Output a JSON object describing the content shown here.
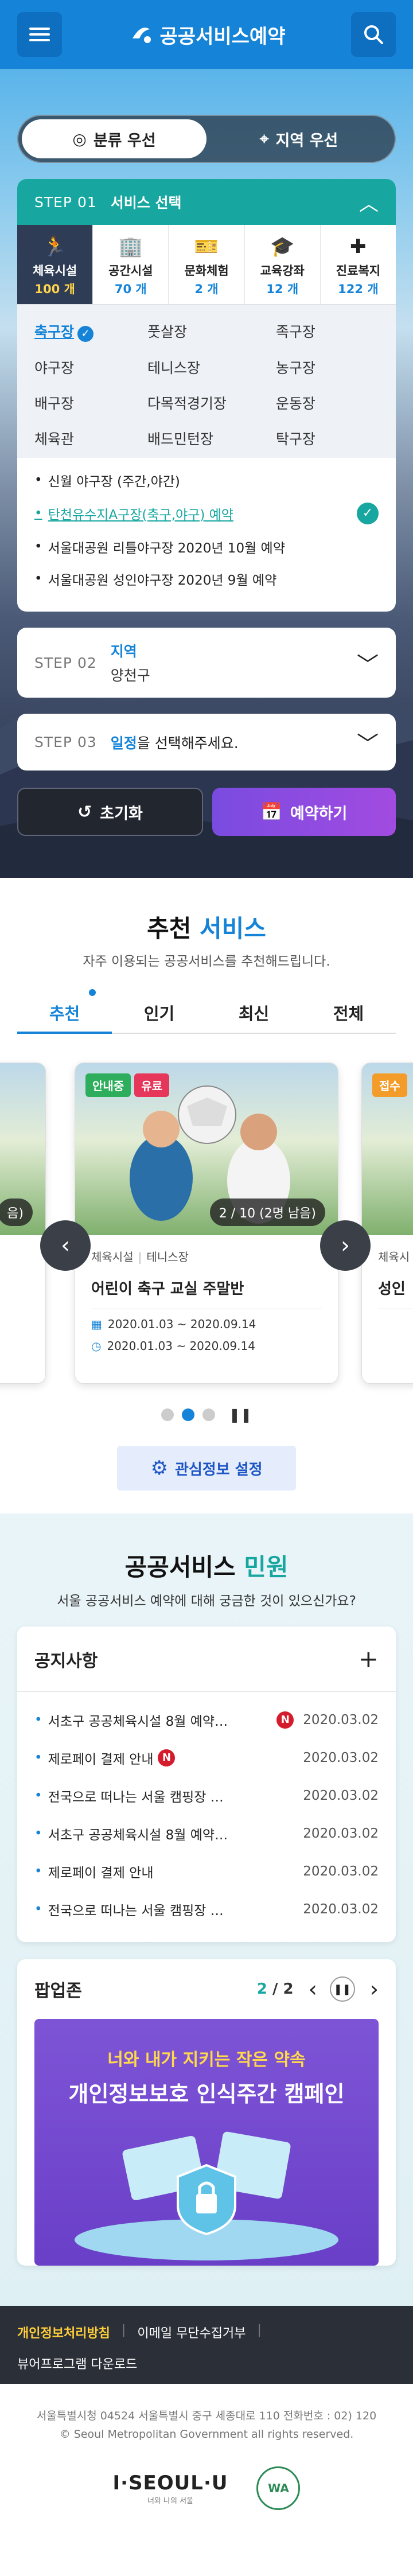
{
  "header": {
    "title": "공공서비스예약",
    "menu_icon": "hamburger-icon",
    "search_icon": "search-icon"
  },
  "toggle": {
    "options": [
      {
        "label": "분류 우선",
        "icon": "target-icon",
        "active": true
      },
      {
        "label": "지역 우선",
        "icon": "location-pin-icon",
        "active": false
      }
    ]
  },
  "step1": {
    "num": "STEP 01",
    "title": "서비스 선택",
    "categories": [
      {
        "name": "체육시설",
        "count": "100 개",
        "icon": "running-icon",
        "active": true
      },
      {
        "name": "공간시설",
        "count": "70 개",
        "icon": "building-icon",
        "active": false
      },
      {
        "name": "문화체험",
        "count": "2 개",
        "icon": "ticket-icon",
        "active": false
      },
      {
        "name": "교육강좌",
        "count": "12 개",
        "icon": "graduation-cap-icon",
        "active": false
      },
      {
        "name": "진료복지",
        "count": "122 개",
        "icon": "medical-icon",
        "active": false
      }
    ],
    "sub_types": [
      {
        "label": "축구장",
        "active": true
      },
      {
        "label": "풋살장",
        "active": false
      },
      {
        "label": "족구장",
        "active": false
      },
      {
        "label": "야구장",
        "active": false
      },
      {
        "label": "테니스장",
        "active": false
      },
      {
        "label": "농구장",
        "active": false
      },
      {
        "label": "배구장",
        "active": false
      },
      {
        "label": "다목적경기장",
        "active": false
      },
      {
        "label": "운동장",
        "active": false
      },
      {
        "label": "체육관",
        "active": false
      },
      {
        "label": "배드민턴장",
        "active": false
      },
      {
        "label": "탁구장",
        "active": false
      }
    ],
    "facilities": [
      {
        "label": "신월 야구장 (주간,야간)",
        "selected": false
      },
      {
        "label": "탄천유수지A구장(축구,야구) 예약",
        "selected": true
      },
      {
        "label": "서울대공원 리틀야구장 2020년 10월 예약",
        "selected": false
      },
      {
        "label": "서울대공원 성인야구장 2020년 9월 예약",
        "selected": false
      }
    ]
  },
  "step2": {
    "num": "STEP 02",
    "title": "지역",
    "value": "양천구"
  },
  "step3": {
    "num": "STEP 03",
    "highlight": "일정",
    "rest": "을 선택해주세요."
  },
  "actions": {
    "reset": "초기화",
    "book": "예약하기"
  },
  "recommend": {
    "title_prefix": "추천 ",
    "title_highlight": "서비스",
    "subtitle": "자주 이용되는 공공서비스를 추천해드립니다.",
    "tabs": [
      {
        "label": "추천",
        "active": true
      },
      {
        "label": "인기",
        "active": false
      },
      {
        "label": "최신",
        "active": false
      },
      {
        "label": "전체",
        "active": false
      }
    ],
    "cards": [
      {
        "badges": [
          "안내중",
          "유료"
        ],
        "count": "2 / 10 (2명 남음)",
        "category": "체육시설",
        "subcategory": "테니스장",
        "title": "어린이 축구 교실 주말반",
        "date1": "2020.01.03 ~ 2020.09.14",
        "date2": "2020.01.03 ~ 2020.09.14"
      }
    ],
    "left_partial_text": "음)",
    "right_partial_badge": "접수",
    "right_partial_meta": "체육시",
    "right_partial_title": "성인",
    "interest_label": "관심정보 설정"
  },
  "civil": {
    "title_prefix": "공공서비스 ",
    "title_highlight": "민원",
    "subtitle": "서울 공공서비스 예약에 대해 궁금한 것이 있으신가요?",
    "notice_title": "공지사항",
    "notices": [
      {
        "title": "서초구 공공체육시설 8월 예약…",
        "new": true,
        "date": "2020.03.02"
      },
      {
        "title": "제로페이 결제 안내",
        "new": true,
        "date": "2020.03.02"
      },
      {
        "title": "전국으로 떠나는 서울 캠핑장 …",
        "new": false,
        "date": "2020.03.02"
      },
      {
        "title": "서초구 공공체육시설 8월 예약…",
        "new": false,
        "date": "2020.03.02"
      },
      {
        "title": "제로페이 결제 안내",
        "new": false,
        "date": "2020.03.02"
      },
      {
        "title": "전국으로 떠나는 서울 캠핑장 …",
        "new": false,
        "date": "2020.03.02"
      }
    ],
    "new_badge": "N",
    "popup_title": "팝업존",
    "popup_page": "2",
    "popup_total": "2",
    "banner_line1": "너와 내가 지키는 작은 약속",
    "banner_line2": "개인정보보호 인식주간 캠페인"
  },
  "footer": {
    "links": [
      "개인정보처리방침",
      "이메일 무단수집거부",
      "뷰어프로그램 다운로드"
    ],
    "address": "서울특별시청 04524 서울특별시 중구 세종대로 110 전화번호 : 02) 120",
    "copyright": "© Seoul Metropolitan Government all rights reserved.",
    "seoul_logo": "I·SEOUL·U",
    "seoul_tag": "너와 나의 서울",
    "wa_mark": "WA"
  },
  "colors": {
    "primary": "#1584d8",
    "teal": "#17a7a0",
    "purple": "#8b4be0",
    "dark": "#2b2f38"
  }
}
